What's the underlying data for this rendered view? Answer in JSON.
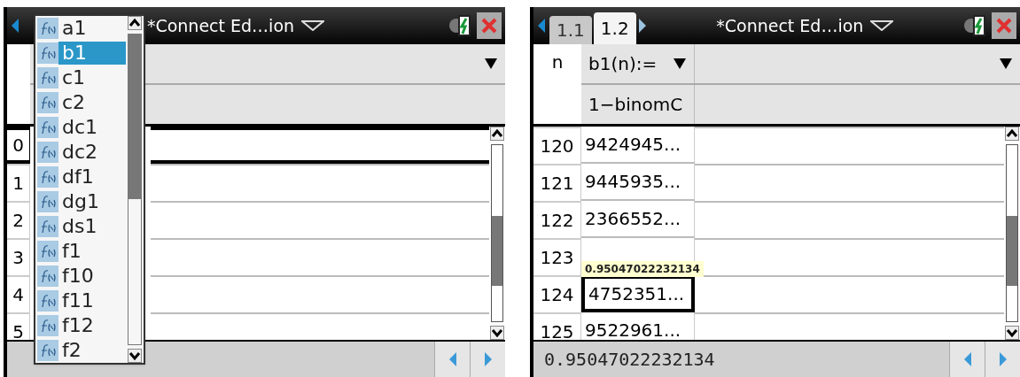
{
  "screens": [
    {
      "title": "*Connect Ed…ion",
      "rows": [
        {
          "n": "0",
          "selected": true
        },
        {
          "n": "1",
          "selected": false
        },
        {
          "n": "2",
          "selected": false
        },
        {
          "n": "3",
          "selected": false
        },
        {
          "n": "4",
          "selected": false
        },
        {
          "n": "5",
          "selected": false
        }
      ],
      "dropdown": {
        "items": [
          {
            "label": "a1",
            "selected": false
          },
          {
            "label": "b1",
            "selected": true
          },
          {
            "label": "c1",
            "selected": false
          },
          {
            "label": "c2",
            "selected": false
          },
          {
            "label": "dc1",
            "selected": false
          },
          {
            "label": "dc2",
            "selected": false
          },
          {
            "label": "df1",
            "selected": false
          },
          {
            "label": "dg1",
            "selected": false
          },
          {
            "label": "ds1",
            "selected": false
          },
          {
            "label": "f1",
            "selected": false
          },
          {
            "label": "f10",
            "selected": false
          },
          {
            "label": "f11",
            "selected": false
          },
          {
            "label": "f12",
            "selected": false
          },
          {
            "label": "f2",
            "selected": false
          }
        ]
      }
    },
    {
      "title": "*Connect Ed…ion",
      "tabs": [
        {
          "label": "1.1",
          "selected": false
        },
        {
          "label": "1.2",
          "selected": true
        }
      ],
      "n_header": "n",
      "columns": [
        {
          "header": "b1(n):=",
          "formula": "1−binomC"
        }
      ],
      "rows": [
        {
          "n": "120",
          "cells": [
            {
              "value": "9424945...",
              "selected": false
            }
          ]
        },
        {
          "n": "121",
          "cells": [
            {
              "value": "9445935...",
              "selected": false
            }
          ]
        },
        {
          "n": "122",
          "cells": [
            {
              "value": "2366552...",
              "selected": false
            }
          ]
        },
        {
          "n": "123",
          "cells": [
            {
              "selected": false
            }
          ]
        },
        {
          "n": "124",
          "cells": [
            {
              "value": "4752351...",
              "selected": true
            }
          ]
        },
        {
          "n": "125",
          "cells": [
            {
              "value": "9522961...",
              "selected": false
            }
          ]
        }
      ],
      "entry": "0.95047022232134",
      "tooltip": "0.95047022232134"
    }
  ]
}
